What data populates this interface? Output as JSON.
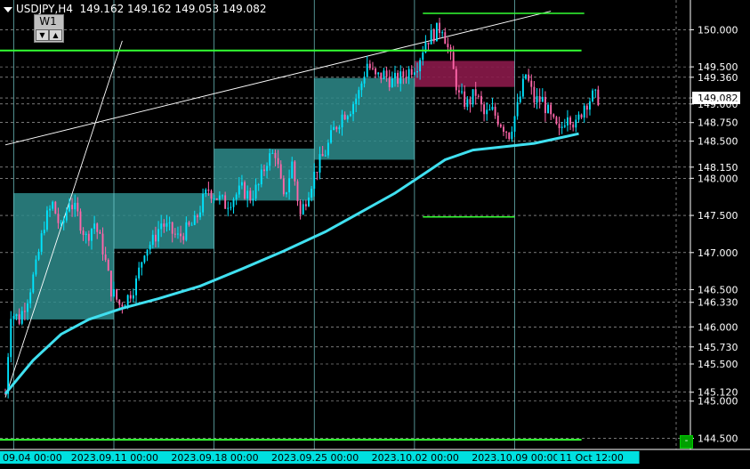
{
  "header": {
    "symbol_info": "USDJPY,H4  149.162 149.162 149.053 149.082",
    "period_button": "W1",
    "down_arrow": "▼",
    "up_arrow": "▲",
    "green_button": "-"
  },
  "colors": {
    "background": "#000000",
    "bull_candle": "#00e5ff",
    "bear_candle": "#ff66aa",
    "ma_line": "#40e0f0",
    "level_green": "#33ff33",
    "box_teal": "#2e8b8b",
    "box_magenta": "#8b1a4a",
    "grid": "#bfbfbf",
    "vline": "#7fdfe0",
    "date_bg": "#00e0e0"
  },
  "chart_data": {
    "type": "candlestick",
    "symbol": "USDJPY",
    "timeframe": "H4",
    "last_quote": {
      "bid": 149.162,
      "high": 149.162,
      "low": 149.053,
      "close": 149.082
    },
    "price_axis": {
      "min": 144.35,
      "max": 150.4,
      "ticks": [
        "150.000",
        "149.500",
        "149.360",
        "149.082",
        "149.000",
        "148.750",
        "148.500",
        "148.150",
        "148.000",
        "147.500",
        "147.000",
        "146.500",
        "146.330",
        "146.000",
        "145.730",
        "145.500",
        "145.120",
        "145.000",
        "144.500"
      ],
      "current_price": "149.082"
    },
    "time_axis": {
      "labels": [
        "09.04 00:00",
        "2023.09.11 00:00",
        "2023.09.18 00:00",
        "2023.09.25 00:00",
        "2023.10.02 00:00",
        "2023.10.09 00:00",
        "11 Oct 12:00"
      ],
      "index_range": [
        0,
        218
      ],
      "label_indices": [
        0,
        42,
        78,
        114,
        150,
        186,
        213
      ],
      "week_separator_indices": [
        3,
        39,
        75,
        111,
        147,
        183
      ]
    },
    "horizontal_levels": [
      149.72,
      144.48
    ],
    "segment_levels": [
      {
        "price": 150.22,
        "from_index": 150,
        "to_index": 208
      },
      {
        "price": 147.48,
        "from_index": 150,
        "to_index": 183
      }
    ],
    "trend_channel": [
      {
        "from": [
          0,
          145.05
        ],
        "to": [
          42,
          149.85
        ]
      },
      {
        "from": [
          0,
          148.45
        ],
        "to": [
          196,
          150.25
        ]
      }
    ],
    "range_boxes": [
      {
        "from_index": 3,
        "to_index": 39,
        "high": 147.8,
        "low": 146.1
      },
      {
        "from_index": 39,
        "to_index": 75,
        "high": 147.8,
        "low": 147.05
      },
      {
        "from_index": 75,
        "to_index": 111,
        "high": 148.4,
        "low": 147.7
      },
      {
        "from_index": 111,
        "to_index": 147,
        "high": 149.35,
        "low": 148.25
      },
      {
        "from_index": 147,
        "to_index": 183,
        "high": 149.58,
        "low": 149.23,
        "bearish": true
      }
    ],
    "ma": [
      [
        0,
        145.1
      ],
      [
        10,
        145.55
      ],
      [
        20,
        145.9
      ],
      [
        30,
        146.1
      ],
      [
        42,
        146.25
      ],
      [
        55,
        146.38
      ],
      [
        70,
        146.55
      ],
      [
        85,
        146.78
      ],
      [
        100,
        147.02
      ],
      [
        115,
        147.28
      ],
      [
        128,
        147.55
      ],
      [
        140,
        147.8
      ],
      [
        150,
        148.05
      ],
      [
        158,
        148.25
      ],
      [
        168,
        148.38
      ],
      [
        178,
        148.42
      ],
      [
        190,
        148.47
      ],
      [
        200,
        148.55
      ],
      [
        206,
        148.6
      ]
    ],
    "close_path": [
      [
        0,
        145.1
      ],
      [
        2,
        146.2
      ],
      [
        5,
        146.1
      ],
      [
        8,
        146.4
      ],
      [
        11,
        146.8
      ],
      [
        14,
        147.4
      ],
      [
        17,
        147.65
      ],
      [
        20,
        147.3
      ],
      [
        23,
        147.7
      ],
      [
        26,
        147.5
      ],
      [
        29,
        147.2
      ],
      [
        32,
        147.4
      ],
      [
        35,
        147.05
      ],
      [
        38,
        146.5
      ],
      [
        41,
        146.3
      ],
      [
        44,
        146.4
      ],
      [
        47,
        146.6
      ],
      [
        50,
        147.05
      ],
      [
        53,
        147.15
      ],
      [
        56,
        147.4
      ],
      [
        59,
        147.3
      ],
      [
        62,
        147.2
      ],
      [
        65,
        147.3
      ],
      [
        68,
        147.4
      ],
      [
        71,
        147.7
      ],
      [
        73,
        147.85
      ],
      [
        76,
        147.75
      ],
      [
        79,
        147.65
      ],
      [
        82,
        147.75
      ],
      [
        85,
        147.85
      ],
      [
        88,
        147.75
      ],
      [
        91,
        147.9
      ],
      [
        94,
        148.25
      ],
      [
        97,
        148.35
      ],
      [
        100,
        147.7
      ],
      [
        103,
        148.2
      ],
      [
        106,
        147.5
      ],
      [
        109,
        147.85
      ],
      [
        112,
        148.15
      ],
      [
        115,
        148.35
      ],
      [
        118,
        148.65
      ],
      [
        121,
        148.85
      ],
      [
        124,
        148.95
      ],
      [
        127,
        149.15
      ],
      [
        130,
        149.55
      ],
      [
        133,
        149.35
      ],
      [
        136,
        149.4
      ],
      [
        139,
        149.3
      ],
      [
        142,
        149.35
      ],
      [
        145,
        149.45
      ],
      [
        148,
        149.55
      ],
      [
        151,
        149.85
      ],
      [
        154,
        149.95
      ],
      [
        157,
        150.05
      ],
      [
        160,
        149.6
      ],
      [
        163,
        149.1
      ],
      [
        166,
        149.0
      ],
      [
        169,
        149.15
      ],
      [
        172,
        148.85
      ],
      [
        175,
        148.9
      ],
      [
        178,
        148.75
      ],
      [
        181,
        148.6
      ],
      [
        184,
        148.95
      ],
      [
        187,
        149.4
      ],
      [
        190,
        149.05
      ],
      [
        193,
        149.05
      ],
      [
        196,
        148.8
      ],
      [
        199,
        148.6
      ],
      [
        202,
        148.9
      ],
      [
        205,
        148.7
      ],
      [
        208,
        149.0
      ],
      [
        211,
        149.1
      ],
      [
        213,
        149.08
      ]
    ]
  }
}
